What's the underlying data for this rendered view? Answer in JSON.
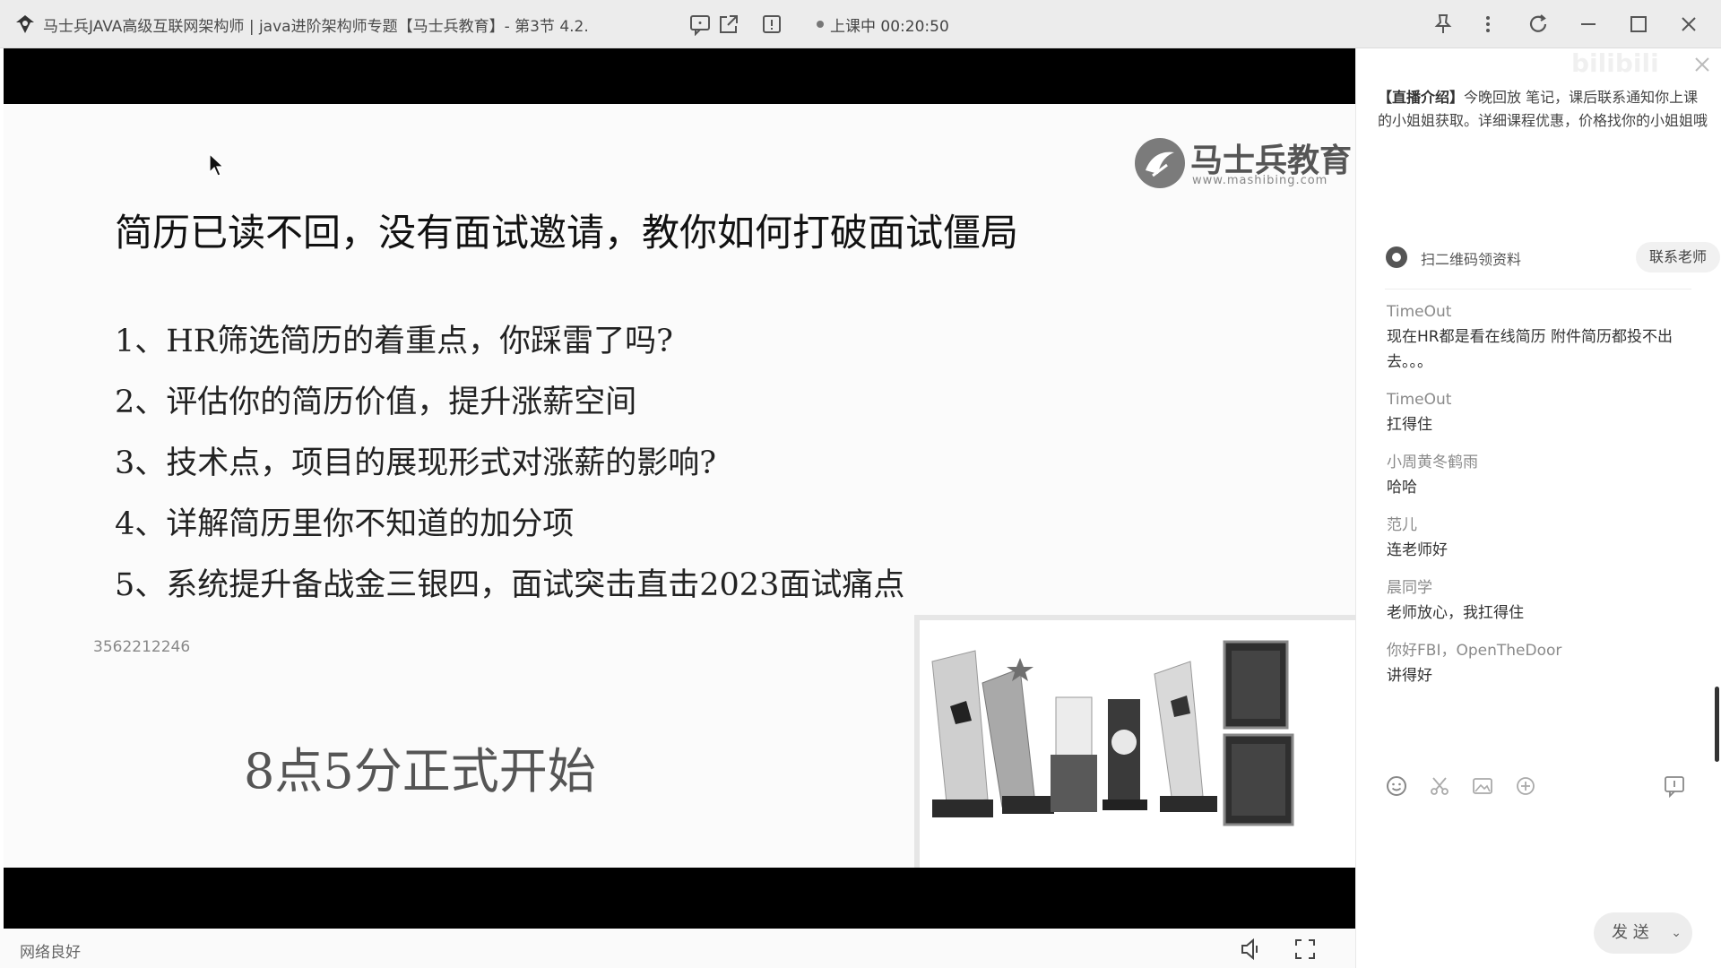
{
  "window": {
    "title": "马士兵JAVA高级互联网架构师 | java进阶架构师专题【马士兵教育】- 第3节 4.2.",
    "live_status": "上课中 00:20:50"
  },
  "slide": {
    "logo_text": "马士兵教育",
    "logo_url": "www.mashibing.com",
    "heading": "简历已读不回，没有面试邀请，教你如何打破面试僵局",
    "points": [
      "1、HR筛选简历的着重点，你踩雷了吗?",
      "2、评估你的简历价值，提升涨薪空间",
      "3、技术点，项目的展现形式对涨薪的影响?",
      "4、详解简历里你不知道的加分项",
      "5、系统提升备战金三银四，面试突击直击2023面试痛点"
    ],
    "qq": "3562212246",
    "start_time": "8点5分正式开始"
  },
  "bottombar": {
    "network_status": "网络良好"
  },
  "panel": {
    "watermark": "bilibili",
    "intro_tag": "【直播介绍】",
    "intro_text": "今晚回放 笔记，课后联系通知你上课的小姐姐获取。详细课程优惠，价格找你的小姐姐哦",
    "qr_text": "扫二维码领资料",
    "contact_label": "联系老师",
    "messages": [
      {
        "user": "TimeOut",
        "text": "现在HR都是看在线简历 附件简历都投不出去。。。"
      },
      {
        "user": "TimeOut",
        "text": "扛得住"
      },
      {
        "user": "小周黄冬鹤雨",
        "text": "哈哈"
      },
      {
        "user": "范儿",
        "text": "连老师好"
      },
      {
        "user": "晨同学",
        "text": "老师放心，我扛得住"
      },
      {
        "user": "你好FBI，OpenTheDoor",
        "text": "讲得好"
      }
    ],
    "send_label": "发 送"
  },
  "colors": {
    "band": "#000000",
    "titlebar": "#ececec",
    "accent_text": "#333333"
  }
}
